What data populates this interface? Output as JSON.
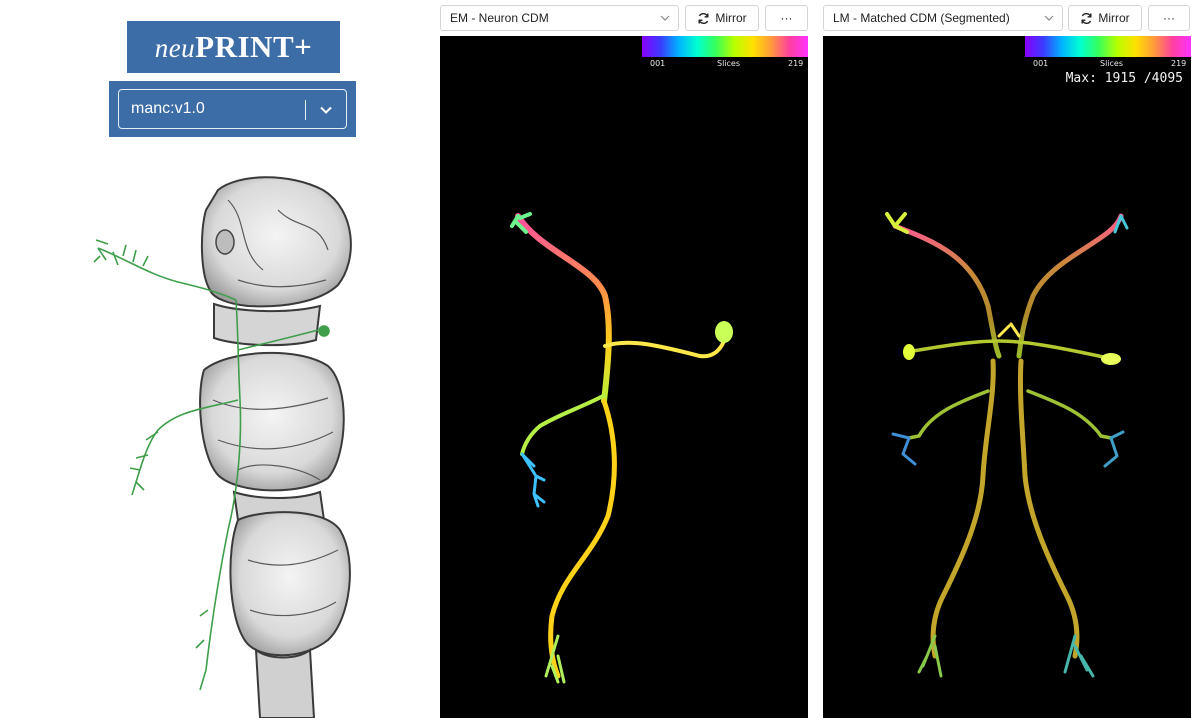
{
  "brand": {
    "lower": "neu",
    "upper": "PRINT+"
  },
  "dataset": {
    "selected": "manc:v1.0"
  },
  "em_panel": {
    "select_label": "EM - Neuron CDM",
    "mirror_label": "Mirror",
    "more_label": "···",
    "colorbar": {
      "min": "001",
      "label": "Slices",
      "max": "219"
    }
  },
  "lm_panel": {
    "select_label": "LM - Matched CDM (Segmented)",
    "mirror_label": "Mirror",
    "more_label": "···",
    "colorbar": {
      "min": "001",
      "label": "Slices",
      "max": "219"
    },
    "max_text": "Max: 1915 /4095"
  },
  "colors": {
    "brand_blue": "#3d6da6",
    "neuron_green": "#3f9e4a",
    "panel_bg": "#000000"
  },
  "icons": [
    "chevron-down-icon",
    "refresh-icon"
  ]
}
